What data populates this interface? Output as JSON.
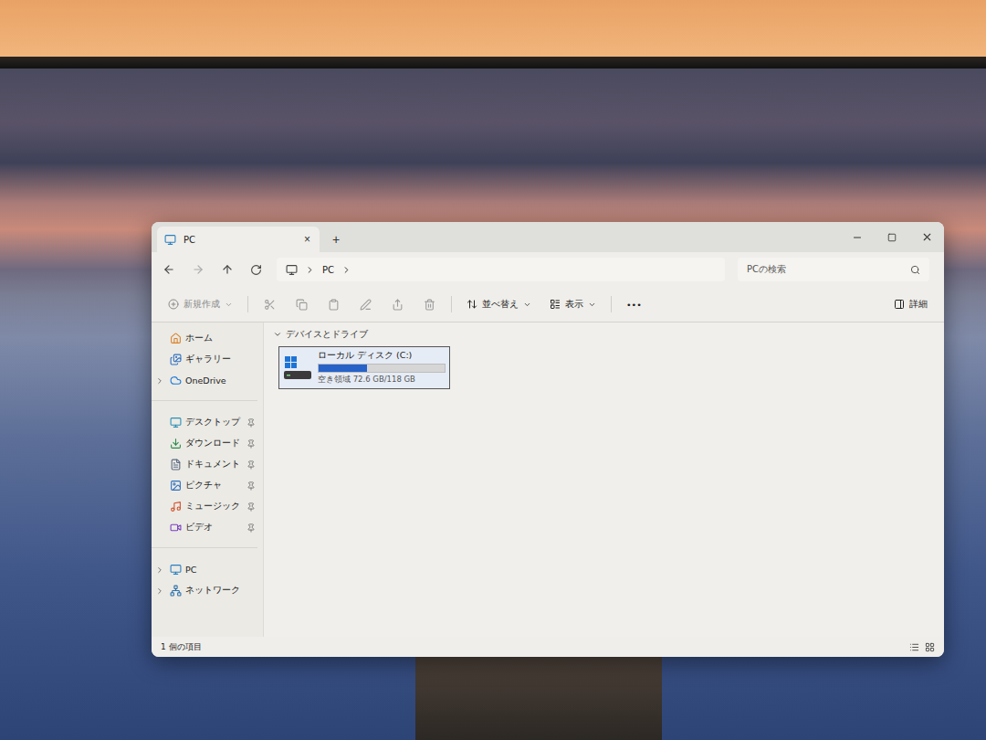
{
  "window": {
    "title": "PC",
    "tab_close": "×",
    "new_tab": "+"
  },
  "address": {
    "crumbs": [
      "PC"
    ]
  },
  "search": {
    "placeholder": "PCの検索"
  },
  "toolbar": {
    "new": {
      "label": "新規作成",
      "disabled": true
    },
    "actions": [
      {
        "disabled": true
      },
      {
        "disabled": true
      },
      {
        "disabled": true
      },
      {
        "disabled": true
      },
      {
        "disabled": true
      },
      {
        "disabled": true
      }
    ],
    "sort": {
      "label": "並べ替え"
    },
    "view": {
      "label": "表示"
    },
    "more": "•••",
    "details": {
      "label": "詳細"
    }
  },
  "sidebar": {
    "groups": [
      [
        {
          "label": "ホーム",
          "pinned": false,
          "expandable": false,
          "expanded": false
        },
        {
          "label": "ギャラリー",
          "pinned": false,
          "expandable": false,
          "expanded": false
        },
        {
          "label": "OneDrive",
          "pinned": false,
          "expandable": true,
          "expanded": false
        }
      ],
      [
        {
          "label": "デスクトップ",
          "pinned": true,
          "expandable": false,
          "expanded": false
        },
        {
          "label": "ダウンロード",
          "pinned": true,
          "expandable": false,
          "expanded": false
        },
        {
          "label": "ドキュメント",
          "pinned": true,
          "expandable": false,
          "expanded": false
        },
        {
          "label": "ピクチャ",
          "pinned": true,
          "expandable": false,
          "expanded": false
        },
        {
          "label": "ミュージック",
          "pinned": true,
          "expandable": false,
          "expanded": false
        },
        {
          "label": "ビデオ",
          "pinned": true,
          "expandable": false,
          "expanded": false
        }
      ],
      [
        {
          "label": "PC",
          "pinned": false,
          "expandable": true,
          "expanded": false
        },
        {
          "label": "ネットワーク",
          "pinned": false,
          "expandable": true,
          "expanded": false
        }
      ]
    ]
  },
  "content": {
    "section": {
      "label": "デバイスとドライブ",
      "expanded": true
    },
    "drives": [
      {
        "name": "ローカル ディスク (C:)",
        "free": "空き領域 72.6 GB/118 GB",
        "level": 0.385,
        "selected": true
      }
    ]
  },
  "status_bar": {
    "count": "1 個の項目"
  }
}
